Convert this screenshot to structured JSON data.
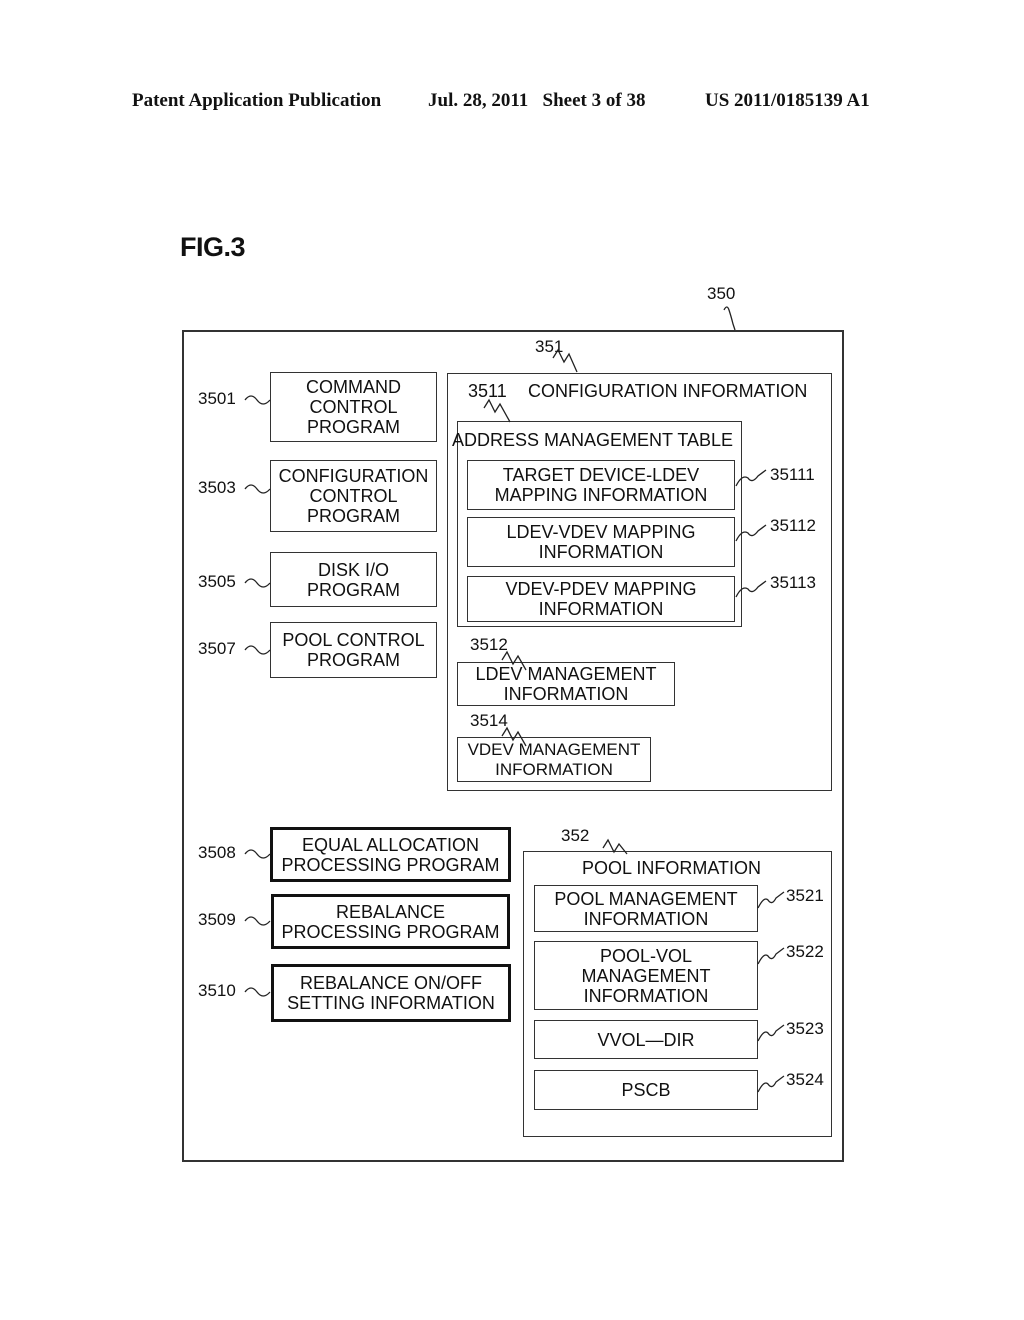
{
  "header": {
    "publication": "Patent Application Publication",
    "date_sheet": "Jul. 28, 2011   Sheet 3 of 38",
    "number": "US 2011/0185139 A1"
  },
  "figure": {
    "title": "FIG.3"
  },
  "diagram": {
    "outer": {
      "ref": "350"
    },
    "programs": [
      {
        "ref": "3501",
        "label": "COMMAND\nCONTROL\nPROGRAM"
      },
      {
        "ref": "3503",
        "label": "CONFIGURATION\nCONTROL\nPROGRAM"
      },
      {
        "ref": "3505",
        "label": "DISK I/O\nPROGRAM"
      },
      {
        "ref": "3507",
        "label": "POOL CONTROL\nPROGRAM"
      }
    ],
    "bold_programs": [
      {
        "ref": "3508",
        "label": "EQUAL ALLOCATION\nPROCESSING PROGRAM"
      },
      {
        "ref": "3509",
        "label": "REBALANCE\nPROCESSING PROGRAM"
      },
      {
        "ref": "3510",
        "label": "REBALANCE ON/OFF\nSETTING INFORMATION"
      }
    ],
    "configuration": {
      "ref": "351",
      "title": "CONFIGURATION INFORMATION",
      "address_table": {
        "ref": "3511",
        "title": "ADDRESS MANAGEMENT TABLE",
        "items": [
          {
            "ref": "35111",
            "label": "TARGET DEVICE-LDEV\nMAPPING INFORMATION"
          },
          {
            "ref": "35112",
            "label": "LDEV-VDEV MAPPING\nINFORMATION"
          },
          {
            "ref": "35113",
            "label": "VDEV-PDEV MAPPING\nINFORMATION"
          }
        ]
      },
      "ldev": {
        "ref": "3512",
        "label": "LDEV MANAGEMENT\nINFORMATION"
      },
      "vdev": {
        "ref": "3514",
        "label": "VDEV MANAGEMENT\nINFORMATION"
      }
    },
    "pool": {
      "ref": "352",
      "title": "POOL INFORMATION",
      "items": [
        {
          "ref": "3521",
          "label": "POOL MANAGEMENT\nINFORMATION"
        },
        {
          "ref": "3522",
          "label": "POOL-VOL\nMANAGEMENT\nINFORMATION"
        },
        {
          "ref": "3523",
          "label": "VVOL—DIR"
        },
        {
          "ref": "3524",
          "label": "PSCB"
        }
      ]
    }
  }
}
